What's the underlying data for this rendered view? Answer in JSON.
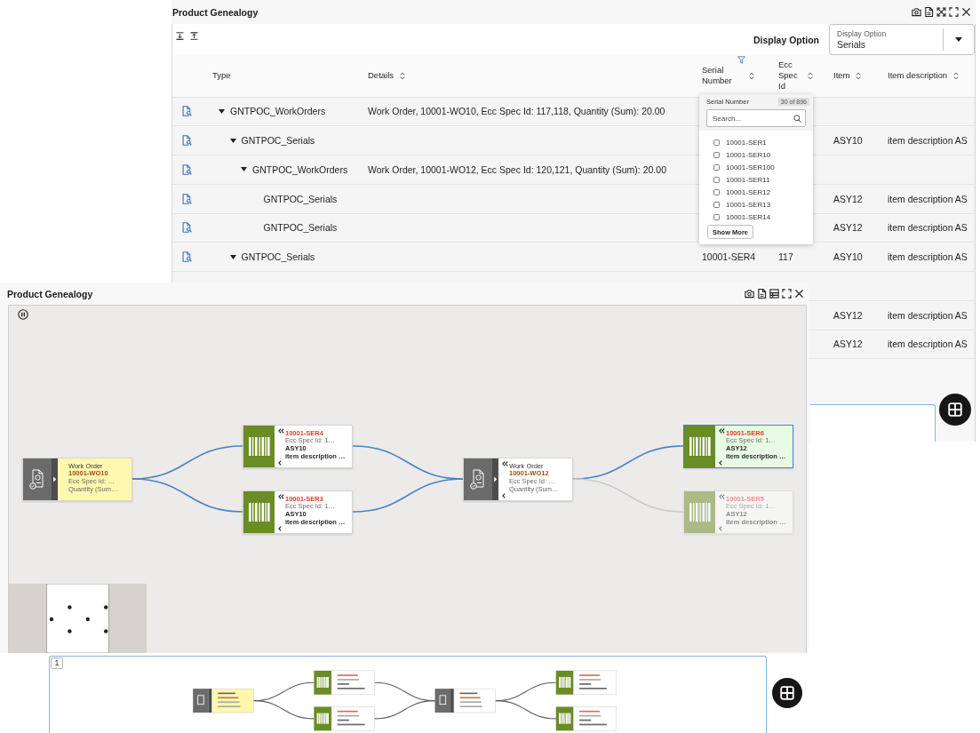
{
  "table_panel": {
    "title": "Product Genealogy",
    "toolbar": {
      "display_option_label": "Display Option",
      "display_option": {
        "label": "Display Option",
        "value": "Serials"
      }
    },
    "columns": [
      {
        "label": "Type",
        "sortable": false,
        "filtered": false
      },
      {
        "label": "Details",
        "sortable": true,
        "filtered": false
      },
      {
        "label": "Serial Number",
        "sortable": true,
        "filtered": true
      },
      {
        "label": "Ecc Spec Id",
        "sortable": true,
        "filtered": false
      },
      {
        "label": "Item",
        "sortable": true,
        "filtered": false
      },
      {
        "label": "Item description",
        "sortable": true,
        "filtered": false
      }
    ],
    "rows": [
      {
        "type": "GNTPOC_WorkOrders",
        "details": "Work Order, 10001-WO10, Ecc Spec Id: 117,118, Quantity (Sum): 20.00",
        "expanded": true,
        "children": [
          {
            "type": "GNTPOC_Serials",
            "item": "ASY10",
            "item_description": "item description AS",
            "expanded": true,
            "children": [
              {
                "type": "GNTPOC_WorkOrders",
                "details": "Work Order, 10001-WO12, Ecc Spec Id: 120,121, Quantity (Sum): 20.00",
                "expanded": true,
                "children": [
                  {
                    "type": "GNTPOC_Serials",
                    "item": "ASY12",
                    "item_description": "item description AS"
                  },
                  {
                    "type": "GNTPOC_Serials",
                    "item": "ASY12",
                    "item_description": "item description AS"
                  }
                ]
              }
            ]
          },
          {
            "type": "GNTPOC_Serials",
            "serial_number": "10001-SER4",
            "ecc_spec_id": "117",
            "item": "ASY10",
            "item_description": "item description AS",
            "expanded": true,
            "children": [
              {
                "children": [
                  {
                    "item": "ASY12",
                    "item_description": "item description AS"
                  },
                  {
                    "item": "ASY12",
                    "item_description": "item description AS"
                  }
                ]
              }
            ]
          }
        ]
      }
    ],
    "filter_popup": {
      "title": "Serial Number",
      "count": "30 of 896",
      "search": {
        "placeholder": "Search..."
      },
      "options": [
        {
          "label": "10001-SER1",
          "checked": false
        },
        {
          "label": "10001-SER10",
          "checked": false
        },
        {
          "label": "10001-SER100",
          "checked": false
        },
        {
          "label": "10001-SER11",
          "checked": false
        },
        {
          "label": "10001-SER12",
          "checked": false
        },
        {
          "label": "10001-SER13",
          "checked": false
        },
        {
          "label": "10001-SER14",
          "checked": false
        }
      ],
      "show_more": "Show More"
    }
  },
  "graph_panel": {
    "title": "Product Genealogy",
    "stages": [
      {
        "nodes": [
          {
            "kind": "work_order",
            "title": "Work Order",
            "id": "10001-WO10",
            "spec": "Ecc Spec Id: …",
            "quantity": "Quantity (Sum…",
            "highlighted": true,
            "selected": false,
            "dimmed": false,
            "chevrons": false
          }
        ]
      },
      {
        "nodes": [
          {
            "kind": "serial",
            "id": "10001-SER4",
            "spec": "Ecc Spec Id: 1…",
            "item": "ASY10",
            "description": "item description …",
            "highlighted": false,
            "selected": false,
            "dimmed": false,
            "chevrons": true
          },
          {
            "kind": "serial",
            "id": "10001-SER3",
            "spec": "Ecc Spec Id: 1…",
            "item": "ASY10",
            "description": "item description …",
            "highlighted": false,
            "selected": false,
            "dimmed": false,
            "chevrons": true
          }
        ]
      },
      {
        "nodes": [
          {
            "kind": "work_order",
            "title": "Work Order",
            "id": "10001-WO12",
            "spec": "Ecc Spec Id: …",
            "quantity": "Quantity (Sum…",
            "highlighted": false,
            "selected": false,
            "dimmed": false,
            "chevrons": true
          }
        ]
      },
      {
        "nodes": [
          {
            "kind": "serial",
            "id": "10001-SER6",
            "spec": "Ecc Spec Id: 1…",
            "item": "ASY12",
            "description": "item description …",
            "highlighted": false,
            "selected": true,
            "dimmed": false,
            "chevrons": true
          },
          {
            "kind": "serial",
            "id": "10001-SER5",
            "spec": "Ecc Spec Id: 1…",
            "item": "ASY12",
            "description": "item description …",
            "highlighted": false,
            "selected": false,
            "dimmed": true,
            "chevrons": true
          }
        ]
      }
    ],
    "overview": {
      "page": "1"
    }
  }
}
